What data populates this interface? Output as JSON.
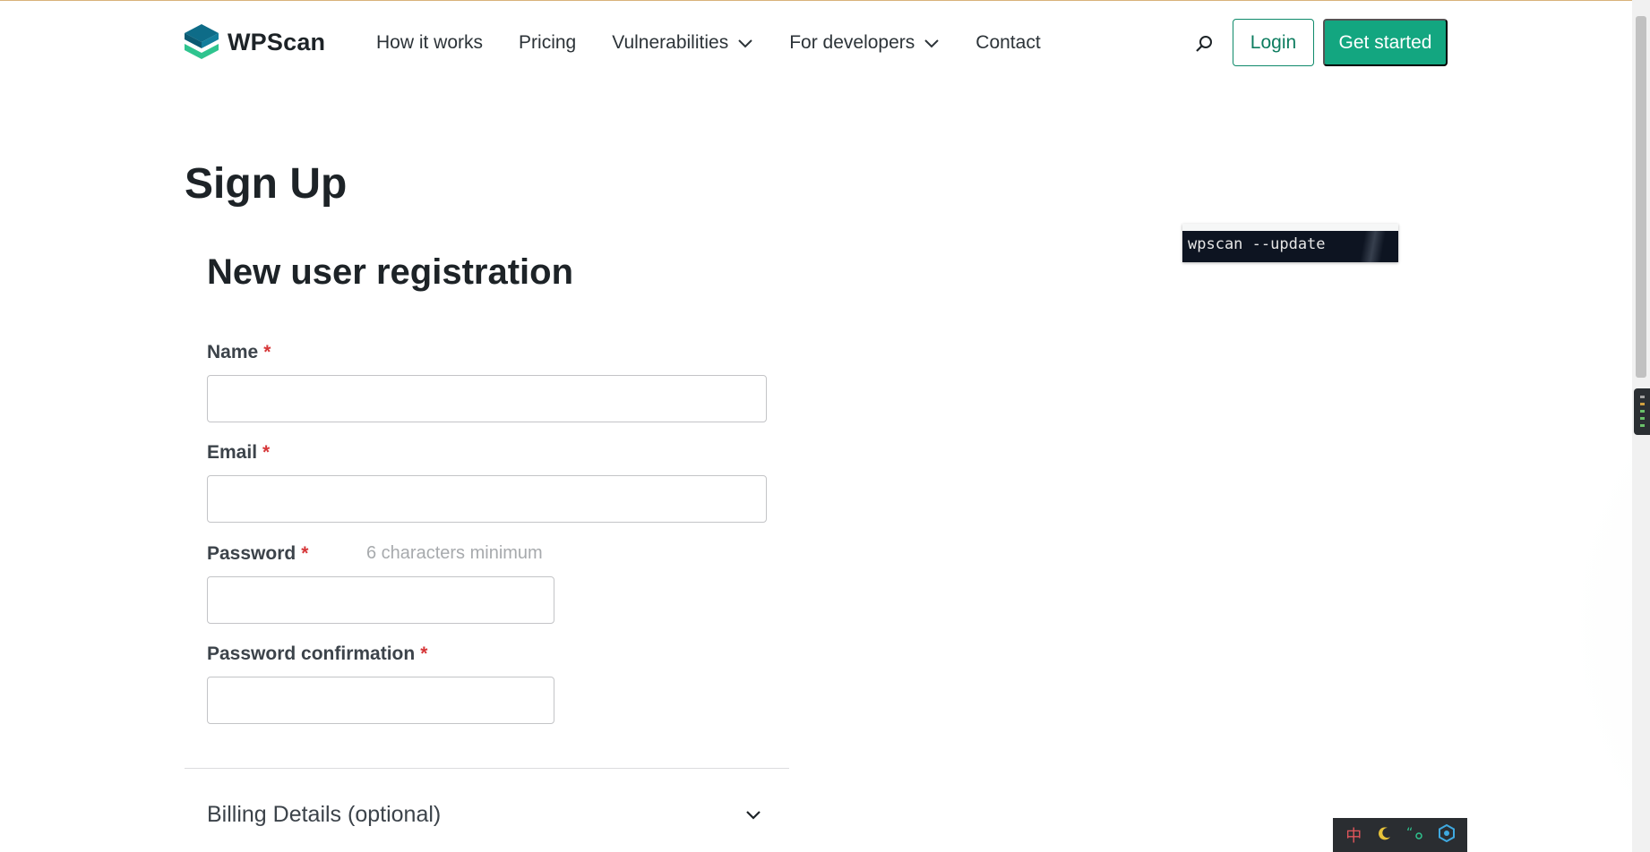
{
  "brand": {
    "name": "WPScan",
    "colors": {
      "accent": "#13a680",
      "logo_dark": "#0e6c88",
      "logo_light": "#2fc48f",
      "required": "#d63638"
    }
  },
  "nav": {
    "items": [
      {
        "label": "How it works",
        "dropdown": false
      },
      {
        "label": "Pricing",
        "dropdown": false
      },
      {
        "label": "Vulnerabilities",
        "dropdown": true
      },
      {
        "label": "For developers",
        "dropdown": true
      },
      {
        "label": "Contact",
        "dropdown": false
      }
    ],
    "search_icon": "search-icon",
    "login_label": "Login",
    "get_started_label": "Get started"
  },
  "page": {
    "title": "Sign Up",
    "section_title": "New user registration",
    "required_marker": "*",
    "fields": {
      "name": {
        "label": "Name",
        "value": ""
      },
      "email": {
        "label": "Email",
        "value": ""
      },
      "password": {
        "label": "Password",
        "hint": "6 characters minimum",
        "value": ""
      },
      "password_confirmation": {
        "label": "Password confirmation",
        "value": ""
      }
    },
    "billing": {
      "label": "Billing Details (optional)",
      "expanded": false
    }
  },
  "terminal": {
    "command": "wpscan --update"
  },
  "ime_toolbar": {
    "items": [
      "中",
      "moon-icon",
      "quote-icon",
      "settings-icon"
    ],
    "lang_label": "中"
  }
}
